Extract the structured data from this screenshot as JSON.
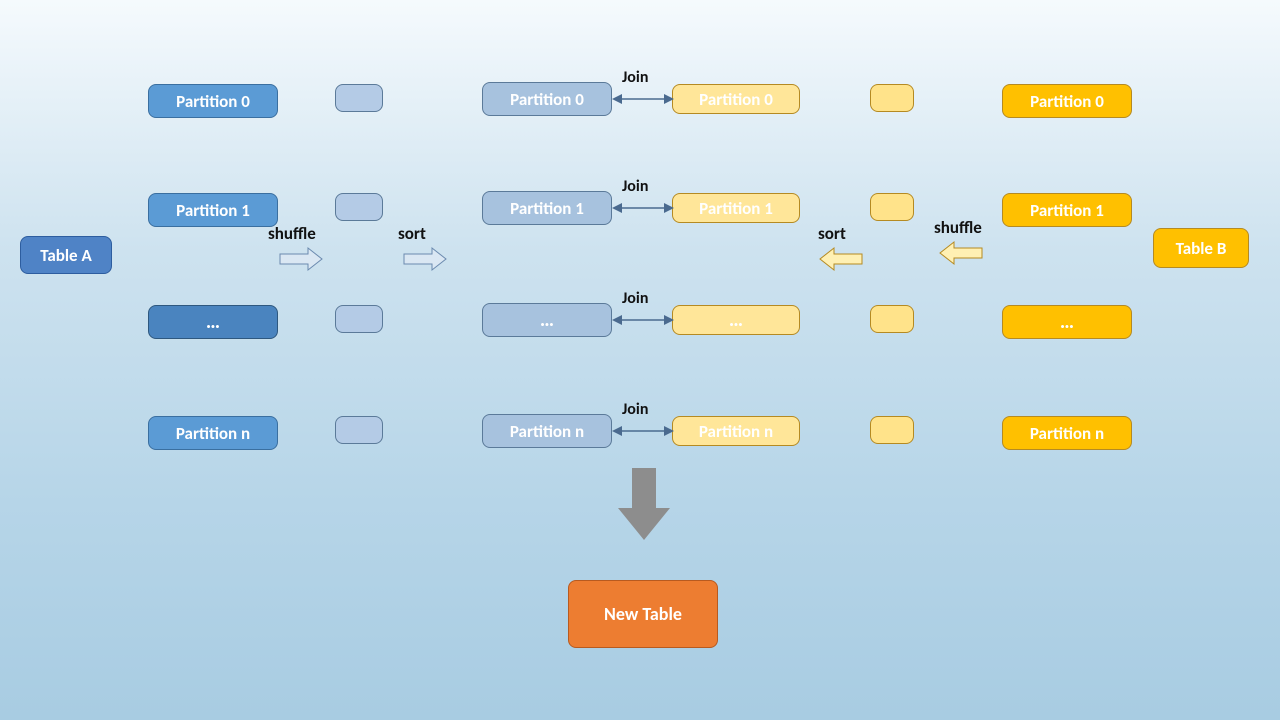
{
  "tables": {
    "left": "Table A",
    "right": "Table B"
  },
  "ops": {
    "shuffle": "shuffle",
    "sort": "sort"
  },
  "joinLabel": "Join",
  "rows": {
    "p0": {
      "left": "Partition 0",
      "midLeft": "Partition 0",
      "midRight": "Partition 0",
      "right": "Partition 0"
    },
    "p1": {
      "left": "Partition 1",
      "midLeft": "Partition 1",
      "midRight": "Partition 1",
      "right": "Partition 1"
    },
    "dots": {
      "left": "…",
      "midLeft": "…",
      "midRight": "…",
      "right": "…"
    },
    "pn": {
      "left": "Partition n",
      "midLeft": "Partition n",
      "midRight": "Partition  n",
      "right": "Partition  n"
    }
  },
  "result": "New Table"
}
